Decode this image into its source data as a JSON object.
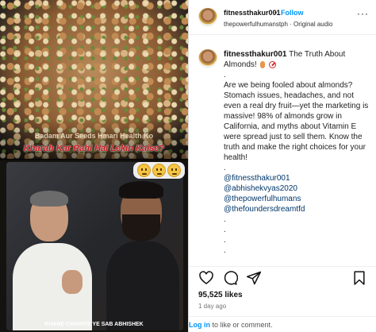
{
  "media": {
    "overlay_line1": "Badam Aur Seeds Hmari Health Ko",
    "overlay_line2": "Kharab Kar Rahi Hai Lekin Kaise?",
    "subtitle": "KHANE CHAHIYE YE SAB ABHISHEK",
    "emojis": [
      "thinking-emoji",
      "thinking-emoji",
      "thinking-emoji"
    ]
  },
  "header": {
    "username": "fitnessthakur001",
    "dot": "•",
    "follow": "Follow",
    "subline": "thepowerfulhumanstph · Original audio",
    "more": "···"
  },
  "caption": {
    "username": "fitnessthakur001",
    "title": "The Truth About Almonds!",
    "dot1": ".",
    "body": "Are we being fooled about almonds? Stomach issues, headaches, and not even a real dry fruit—yet the marketing is massive! 98% of almonds grow in California, and myths about Vitamin E were spread just to sell them. Know the truth and make the right choices for your health!",
    "dot2": ".",
    "mentions": [
      "@fitnessthakur001",
      "@abhishekvyas2020",
      "@thepowerfulhumans",
      "@thefoundersdreamtfd"
    ],
    "trailing_dots": [
      ".",
      ".",
      ".",
      "."
    ]
  },
  "actions": {
    "icons": [
      "heart-icon",
      "comment-icon",
      "share-icon",
      "bookmark-icon"
    ]
  },
  "likes": "95,525 likes",
  "time_ago": "1 day ago",
  "footer": {
    "login": "Log in",
    "rest": " to like or comment."
  }
}
